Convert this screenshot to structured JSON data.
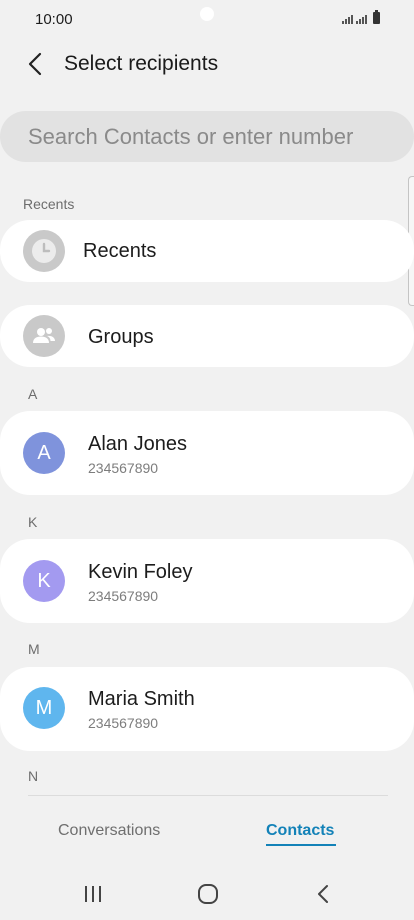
{
  "status_bar": {
    "time": "10:00"
  },
  "header": {
    "title": "Select recipients"
  },
  "search": {
    "placeholder": "Search Contacts or enter number"
  },
  "sections": {
    "recents_label": "Recents",
    "a_label": "A",
    "k_label": "K",
    "m_label": "M",
    "n_label": "N"
  },
  "rows": {
    "recents": {
      "label": "Recents",
      "icon": "clock-icon"
    },
    "groups": {
      "label": "Groups",
      "icon": "people-icon"
    }
  },
  "contacts": [
    {
      "initial": "A",
      "name": "Alan Jones",
      "number": "234567890",
      "color": "#7f93dc"
    },
    {
      "initial": "K",
      "name": "Kevin Foley",
      "number": "234567890",
      "color": "#a39af0"
    },
    {
      "initial": "M",
      "name": "Maria Smith",
      "number": "234567890",
      "color": "#5fb6ee"
    }
  ],
  "tabs": {
    "conversations": "Conversations",
    "contacts": "Contacts",
    "active": "Contacts",
    "active_color": "#1382b8"
  },
  "nav": {
    "recent_apps": "recent-apps-icon",
    "home": "home-icon",
    "back": "back-icon"
  }
}
